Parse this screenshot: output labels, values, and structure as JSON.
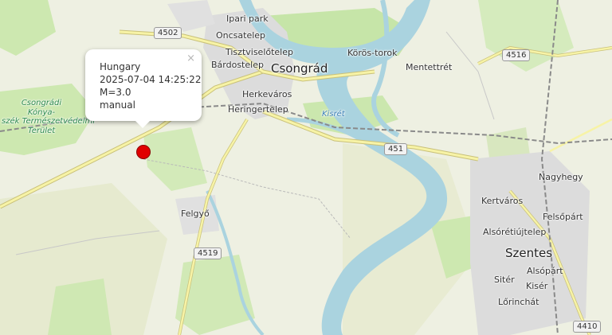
{
  "map": {
    "places": [
      {
        "key": "ipari-park",
        "name": "Ipari park"
      },
      {
        "key": "oncsatelep",
        "name": "Oncsatelep"
      },
      {
        "key": "tisztviselotelep",
        "name": "Tisztviselőtelep"
      },
      {
        "key": "bardostelep",
        "name": "Bárdostelep"
      },
      {
        "key": "csongrad",
        "name": "Csongrád"
      },
      {
        "key": "koros-torok",
        "name": "Körös-torok"
      },
      {
        "key": "mentettret",
        "name": "Mentettrét"
      },
      {
        "key": "herkevaros",
        "name": "Herkeváros"
      },
      {
        "key": "heringertelep",
        "name": "Heringertelep"
      },
      {
        "key": "kisret",
        "name": "Kisrét"
      },
      {
        "key": "nagyhegy",
        "name": "Nagyhegy"
      },
      {
        "key": "kertvaros",
        "name": "Kertváros"
      },
      {
        "key": "felsopart",
        "name": "Felsőpárt"
      },
      {
        "key": "alsoretiujtelep",
        "name": "Alsórétiújtelep"
      },
      {
        "key": "szentes",
        "name": "Szentes"
      },
      {
        "key": "alsopart",
        "name": "Alsópárt"
      },
      {
        "key": "siter",
        "name": "Sitér"
      },
      {
        "key": "kiser",
        "name": "Kisér"
      },
      {
        "key": "lorinchat",
        "name": "Lőrinchát"
      },
      {
        "key": "felgyo",
        "name": "Felgyő"
      }
    ],
    "park_label": [
      "Csongrádi",
      "Kónya-",
      "szék Természetvédelmi",
      "Terület"
    ],
    "road_shields": [
      "4502",
      "4516",
      "451",
      "4519",
      "4410"
    ],
    "colors": {
      "land": "#eef0e2",
      "field": "#e9ecd6",
      "forest": "#cde8b0",
      "water": "#aad3df",
      "urban": "#dcdcdc",
      "road": "#f7f3a6",
      "road_casing": "#c9c17a",
      "marker": "#e00000"
    }
  },
  "popup": {
    "country": "Hungary",
    "datetime": "2025-07-04 14:25:22",
    "magnitude": "M=3.0",
    "mode": "manual",
    "close_symbol": "×"
  }
}
